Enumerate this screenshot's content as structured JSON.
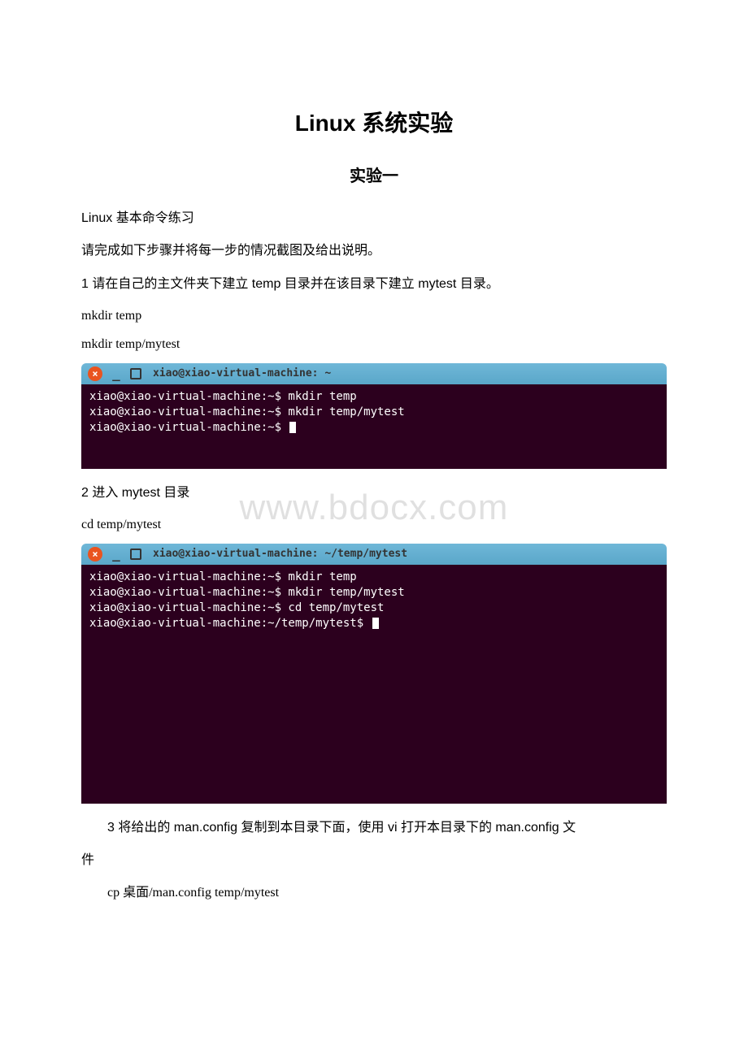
{
  "title": "Linux 系统实验",
  "subtitle": "实验一",
  "intro1": "Linux 基本命令练习",
  "intro2": "请完成如下步骤并将每一步的情况截图及给出说明。",
  "step1": "1 请在自己的主文件夹下建立 temp 目录并在该目录下建立 mytest 目录。",
  "cmd1a": "mkdir temp",
  "cmd1b": "mkdir temp/mytest",
  "term1": {
    "title": "xiao@xiao-virtual-machine: ~",
    "lines": [
      "xiao@xiao-virtual-machine:~$ mkdir temp",
      "xiao@xiao-virtual-machine:~$ mkdir temp/mytest",
      "xiao@xiao-virtual-machine:~$ "
    ]
  },
  "step2": "2 进入 mytest 目录",
  "cmd2": "cd temp/mytest",
  "term2": {
    "title": "xiao@xiao-virtual-machine: ~/temp/mytest",
    "lines": [
      "xiao@xiao-virtual-machine:~$ mkdir temp",
      "xiao@xiao-virtual-machine:~$ mkdir temp/mytest",
      "xiao@xiao-virtual-machine:~$ cd temp/mytest",
      "xiao@xiao-virtual-machine:~/temp/mytest$ "
    ]
  },
  "step3a": "3 将给出的 man.config 复制到本目录下面，使用 vi 打开本目录下的 man.config 文",
  "step3b": "件",
  "cmd3": "cp 桌面/man.config temp/mytest",
  "watermark": "www.bdocx.com"
}
